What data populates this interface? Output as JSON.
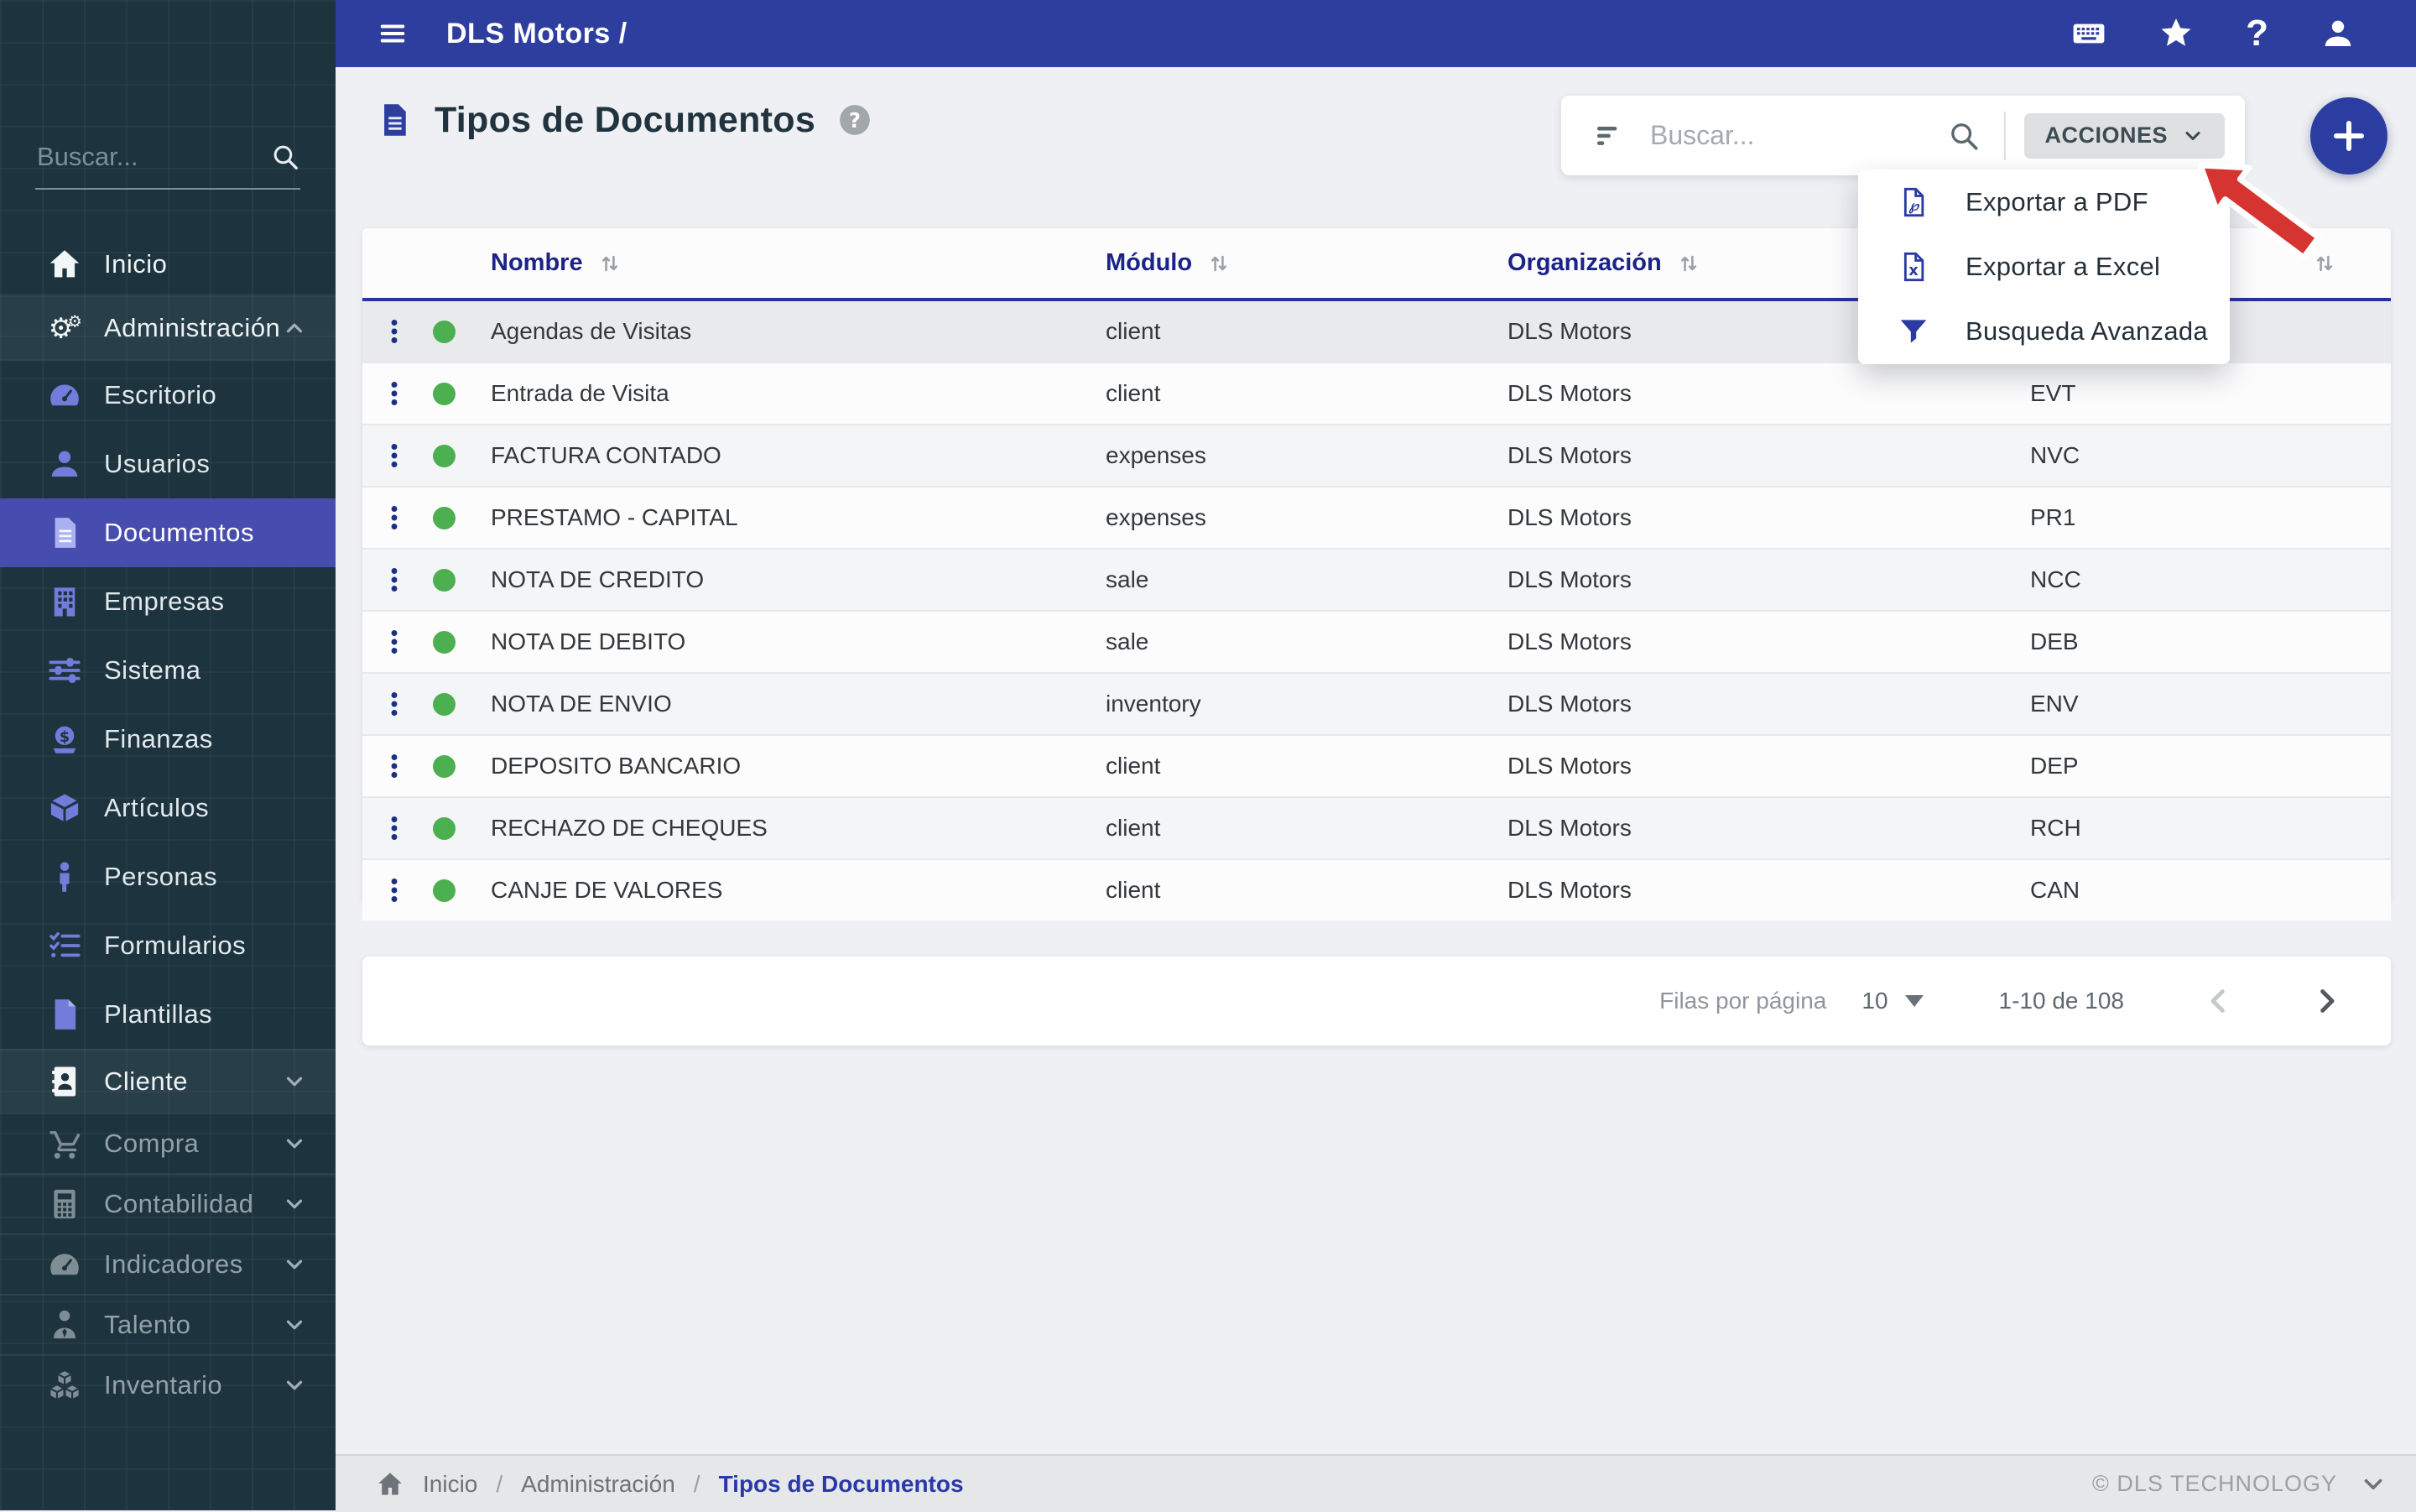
{
  "colors": {
    "topbar_blue": "#2e3e9e",
    "sidebar_bg": "#1d343f",
    "active_item_bg": "#474dae",
    "icon_purple": "#727cda",
    "status_green": "#4caf50",
    "header_navy": "#1b2486",
    "annotation_red": "#d63430"
  },
  "topbar": {
    "title": "DLS Motors /",
    "icons": [
      "keyboard",
      "star",
      "help",
      "user"
    ]
  },
  "sidebar": {
    "search_placeholder": "Buscar...",
    "items": [
      {
        "label": "Inicio",
        "icon": "home"
      },
      {
        "label": "Administración",
        "icon": "gears",
        "expanded": true
      },
      {
        "label": "Escritorio",
        "icon": "gauge"
      },
      {
        "label": "Usuarios",
        "icon": "user"
      },
      {
        "label": "Documentos",
        "icon": "file-lines",
        "active": true
      },
      {
        "label": "Empresas",
        "icon": "building"
      },
      {
        "label": "Sistema",
        "icon": "sliders"
      },
      {
        "label": "Finanzas",
        "icon": "money"
      },
      {
        "label": "Artículos",
        "icon": "cube"
      },
      {
        "label": "Personas",
        "icon": "person"
      },
      {
        "label": "Formularios",
        "icon": "checklist"
      },
      {
        "label": "Plantillas",
        "icon": "file"
      },
      {
        "label": "Cliente",
        "icon": "address-book",
        "collapsed": true
      },
      {
        "label": "Compra",
        "icon": "cart",
        "collapsed": true
      },
      {
        "label": "Contabilidad",
        "icon": "calculator",
        "collapsed": true
      },
      {
        "label": "Indicadores",
        "icon": "gauge",
        "collapsed": true
      },
      {
        "label": "Talento",
        "icon": "person-tie",
        "collapsed": true
      },
      {
        "label": "Inventario",
        "icon": "boxes",
        "collapsed": true
      }
    ]
  },
  "page": {
    "title": "Tipos de Documentos"
  },
  "toolbar": {
    "search_placeholder": "Buscar...",
    "actions_label": "ACCIONES"
  },
  "actions_menu": {
    "items": [
      {
        "icon": "pdf-file",
        "label": "Exportar a PDF"
      },
      {
        "icon": "excel-file",
        "label": "Exportar a Excel"
      },
      {
        "icon": "funnel",
        "label": "Busqueda Avanzada"
      }
    ]
  },
  "table": {
    "headers": {
      "name": "Nombre",
      "module": "Módulo",
      "organization": "Organización",
      "code": ""
    },
    "rows": [
      {
        "name": "Agendas de Visitas",
        "module": "client",
        "org": "DLS Motors",
        "code": "",
        "status": "active"
      },
      {
        "name": "Entrada de Visita",
        "module": "client",
        "org": "DLS Motors",
        "code": "EVT",
        "status": "active"
      },
      {
        "name": "FACTURA CONTADO",
        "module": "expenses",
        "org": "DLS Motors",
        "code": "NVC",
        "status": "active"
      },
      {
        "name": "PRESTAMO - CAPITAL",
        "module": "expenses",
        "org": "DLS Motors",
        "code": "PR1",
        "status": "active"
      },
      {
        "name": "NOTA DE CREDITO",
        "module": "sale",
        "org": "DLS Motors",
        "code": "NCC",
        "status": "active"
      },
      {
        "name": "NOTA DE DEBITO",
        "module": "sale",
        "org": "DLS Motors",
        "code": "DEB",
        "status": "active"
      },
      {
        "name": "NOTA DE ENVIO",
        "module": "inventory",
        "org": "DLS Motors",
        "code": "ENV",
        "status": "active"
      },
      {
        "name": "DEPOSITO BANCARIO",
        "module": "client",
        "org": "DLS Motors",
        "code": "DEP",
        "status": "active"
      },
      {
        "name": "RECHAZO DE CHEQUES",
        "module": "client",
        "org": "DLS Motors",
        "code": "RCH",
        "status": "active"
      },
      {
        "name": "CANJE DE VALORES",
        "module": "client",
        "org": "DLS Motors",
        "code": "CAN",
        "status": "active"
      }
    ]
  },
  "pagination": {
    "rows_per_page_label": "Filas por página",
    "rows_per_page": "10",
    "range": "1-10 de 108",
    "prev_enabled": false,
    "next_enabled": true
  },
  "footer": {
    "breadcrumb": [
      "Inicio",
      "Administración",
      "Tipos de Documentos"
    ],
    "separator": "/",
    "copyright": "© DLS TECHNOLOGY"
  }
}
